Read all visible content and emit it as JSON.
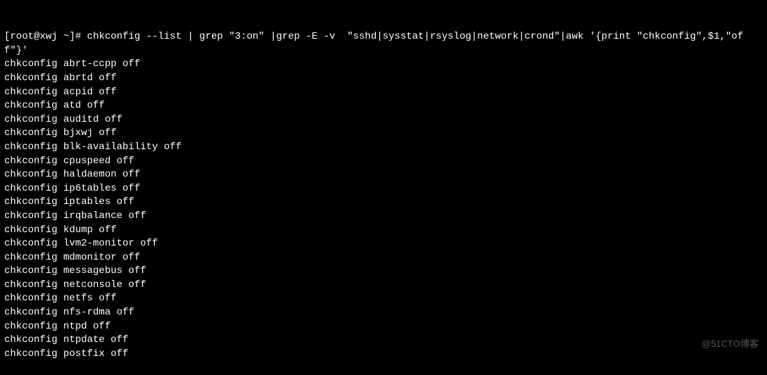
{
  "prompt": {
    "user": "root",
    "host": "xwj",
    "path": "~",
    "symbol": "#",
    "command": "chkconfig --list | grep \"3:on\" |grep -E -v  \"sshd|sysstat|rsyslog|network|crond\"|awk '{print \"chkconfig\",$1,\"off\"}'"
  },
  "output": [
    "chkconfig abrt-ccpp off",
    "chkconfig abrtd off",
    "chkconfig acpid off",
    "chkconfig atd off",
    "chkconfig auditd off",
    "chkconfig bjxwj off",
    "chkconfig blk-availability off",
    "chkconfig cpuspeed off",
    "chkconfig haldaemon off",
    "chkconfig ip6tables off",
    "chkconfig iptables off",
    "chkconfig irqbalance off",
    "chkconfig kdump off",
    "chkconfig lvm2-monitor off",
    "chkconfig mdmonitor off",
    "chkconfig messagebus off",
    "chkconfig netconsole off",
    "chkconfig netfs off",
    "chkconfig nfs-rdma off",
    "chkconfig ntpd off",
    "chkconfig ntpdate off",
    "chkconfig postfix off"
  ],
  "watermark": "@51CTO博客"
}
